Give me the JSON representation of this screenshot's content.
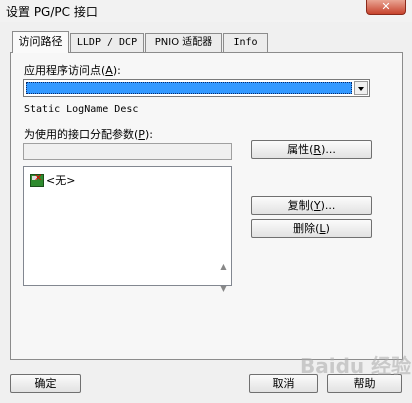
{
  "window": {
    "title": "设置 PG/PC 接口",
    "close_symbol": "✕"
  },
  "tabs": [
    {
      "label": "访问路径",
      "active": true
    },
    {
      "label": "LLDP / DCP",
      "active": false
    },
    {
      "label": "PNIO 适配器",
      "active": false
    },
    {
      "label": "Info",
      "active": false
    }
  ],
  "access_point": {
    "label": "应用程序访问点",
    "accel": "A",
    "selected_value": ""
  },
  "static_logname": "Static LogName Desc",
  "interface_params": {
    "label": "为使用的接口分配参数",
    "accel": "P",
    "value": "",
    "list_items": [
      "<无>"
    ]
  },
  "buttons": {
    "properties": {
      "label": "属性",
      "accel": "R",
      "suffix": "..."
    },
    "copy": {
      "label": "复制",
      "accel": "Y",
      "suffix": "..."
    },
    "delete": {
      "label": "删除",
      "accel": "L",
      "suffix": ""
    },
    "ok": {
      "label": "确定"
    },
    "cancel": {
      "label": "取消"
    },
    "help": {
      "label": "帮助"
    }
  },
  "spinner": {
    "up": "▲",
    "down": "▼"
  },
  "watermark": "Baidu 经验"
}
